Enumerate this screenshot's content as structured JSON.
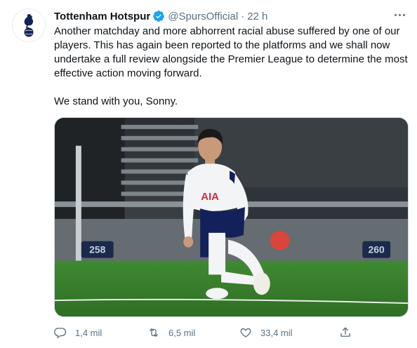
{
  "tweet": {
    "author_name": "Tottenham Hotspur",
    "handle": "@SpursOfficial",
    "separator": "·",
    "time": "22 h",
    "paragraph1": "Another matchday and more abhorrent racial abuse suffered by one of our players. This has again been reported to the platforms and we shall now undertake a full review alongside the Premier League to determine the most effective action moving forward.",
    "paragraph2": "We stand with you, Sonny."
  },
  "media": {
    "shirt_sponsor": "AIA",
    "board_left": "258",
    "board_right": "260"
  },
  "actions": {
    "replies": "1,4 mil",
    "retweets": "6,5 mil",
    "likes": "33,4 mil"
  },
  "icons": {
    "avatar": "spurs-cockerel-logo",
    "verified": "verified-badge-icon",
    "more": "more-options-icon",
    "reply": "reply-icon",
    "retweet": "retweet-icon",
    "like": "heart-icon",
    "share": "share-icon"
  },
  "colors": {
    "verified": "#1da1f2",
    "secondary_text": "#5b7083",
    "primary_text": "#0f1419",
    "navy": "#132257"
  }
}
